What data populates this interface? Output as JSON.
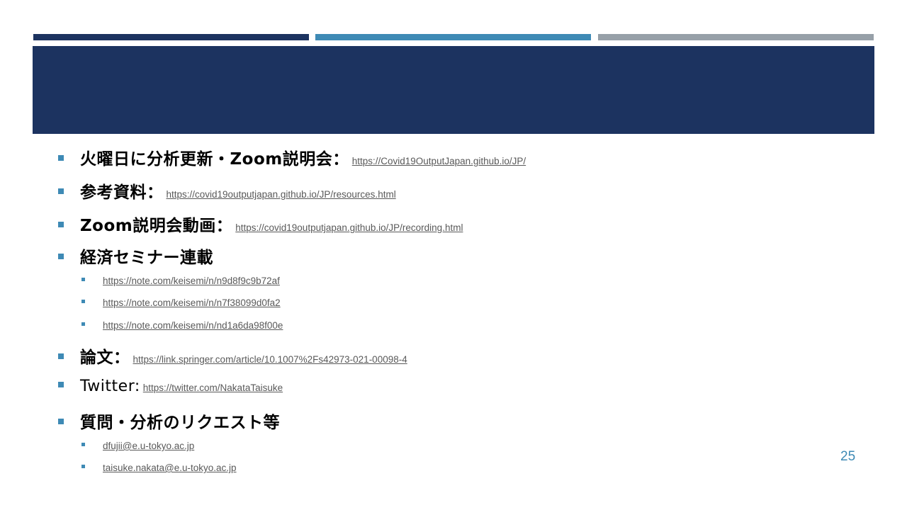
{
  "items": [
    {
      "label": "火曜日に分析更新・Zoom説明会：",
      "link": "https://Covid19OutputJapan.github.io/JP/"
    },
    {
      "label": "参考資料：",
      "link": "https://covid19outputjapan.github.io/JP/resources.html"
    },
    {
      "label": "Zoom説明会動画：",
      "link": "https://covid19outputjapan.github.io/JP/recording.html"
    },
    {
      "label": "経済セミナー連載",
      "sublinks": [
        "https://note.com/keisemi/n/n9d8f9c9b72af",
        "https://note.com/keisemi/n/n7f38099d0fa2",
        "https://note.com/keisemi/n/nd1a6da98f00e"
      ]
    },
    {
      "label": "論文：",
      "link": "https://link.springer.com/article/10.1007%2Fs42973-021-00098-4"
    },
    {
      "label": "Twitter:",
      "link": "https://twitter.com/NakataTaisuke"
    },
    {
      "label": "質問・分析のリクエスト等",
      "sublinks": [
        "dfujii@e.u-tokyo.ac.jp",
        "taisuke.nakata@e.u-tokyo.ac.jp"
      ]
    }
  ],
  "page_number": "25",
  "colors": {
    "navy": "#1c3360",
    "accent": "#3e8ab5",
    "gray": "#97a0a8"
  }
}
